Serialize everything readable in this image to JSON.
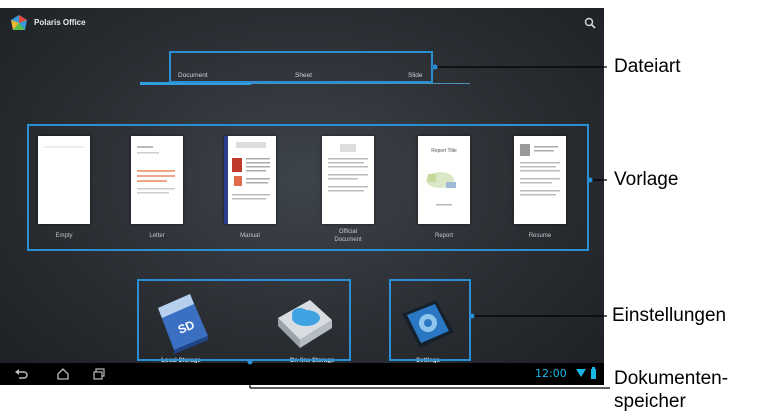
{
  "app": {
    "title": "Polaris Office",
    "logo_icon": "polaris-logo-icon",
    "search_icon": "search-icon"
  },
  "tabs": [
    {
      "label": "Document",
      "active": true
    },
    {
      "label": "Sheet",
      "active": false
    },
    {
      "label": "Slide",
      "active": false
    }
  ],
  "templates": [
    {
      "label": "Empty",
      "icon": "empty-template-icon"
    },
    {
      "label": "Letter",
      "icon": "letter-template-icon"
    },
    {
      "label": "Manual",
      "icon": "manual-template-icon"
    },
    {
      "label": "Official\nDocument",
      "icon": "official-document-template-icon"
    },
    {
      "label": "Report",
      "icon": "report-template-icon"
    },
    {
      "label": "Resume",
      "icon": "resume-template-icon"
    }
  ],
  "report_title": "Report Title",
  "storage": {
    "local": {
      "label": "Local Storage",
      "icon": "sd-card-icon",
      "badge": "SD"
    },
    "online": {
      "label": "On-line Storage",
      "icon": "cloud-storage-icon"
    },
    "settings": {
      "label": "Settings",
      "icon": "settings-tablet-icon"
    }
  },
  "navbar": {
    "time": "12:00",
    "icons": [
      "back-icon",
      "home-icon",
      "recent-apps-icon",
      "wifi-icon",
      "battery-icon"
    ]
  },
  "callouts": {
    "dateiart": "Dateiart",
    "vorlage": "Vorlage",
    "einstellungen": "Einstellungen",
    "dokumentenspeicher_1": "Dokumenten-",
    "dokumentenspeicher_2": "speicher"
  },
  "colors": {
    "accent": "#2fa0dd",
    "highlight_box": "#2b8fd6",
    "screen_bg": "#2a2e33",
    "clock": "#17b8e6"
  }
}
